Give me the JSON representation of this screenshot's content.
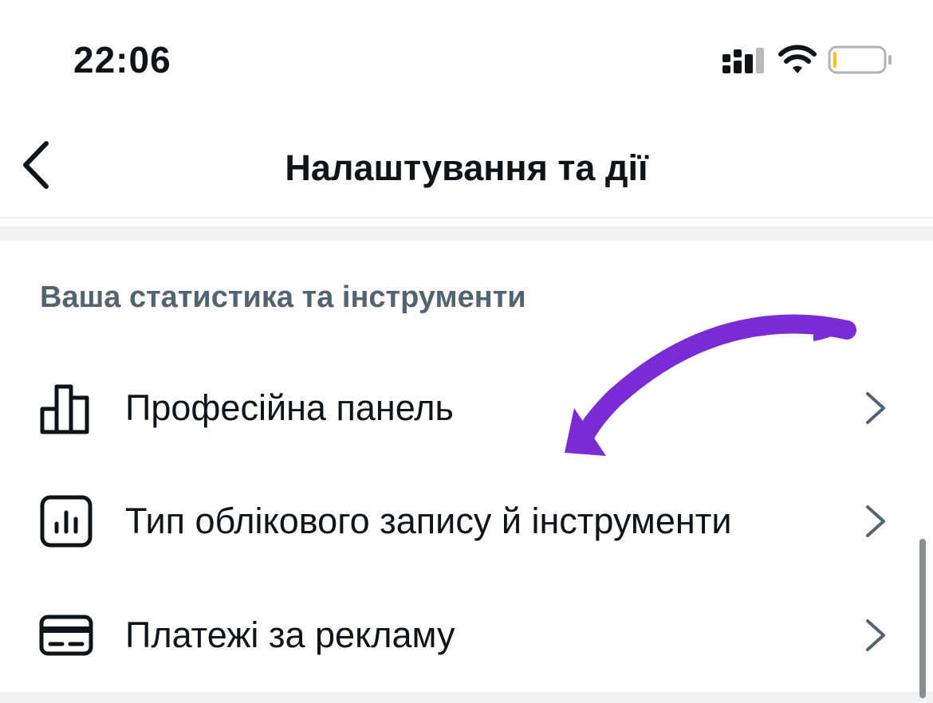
{
  "status_bar": {
    "time": "22:06",
    "battery_color": "#f5c518"
  },
  "header": {
    "title": "Налаштування та дії"
  },
  "section": {
    "title": "Ваша статистика та інструменти",
    "items": [
      {
        "label": "Професійна панель",
        "icon": "bar-chart-icon"
      },
      {
        "label": "Тип облікового запису й інструменти",
        "icon": "analytics-box-icon"
      },
      {
        "label": "Платежі за рекламу",
        "icon": "credit-card-icon"
      }
    ]
  },
  "colors": {
    "annotation_arrow": "#7b2bd6",
    "section_title": "#536471",
    "separator": "#eff3f4"
  }
}
